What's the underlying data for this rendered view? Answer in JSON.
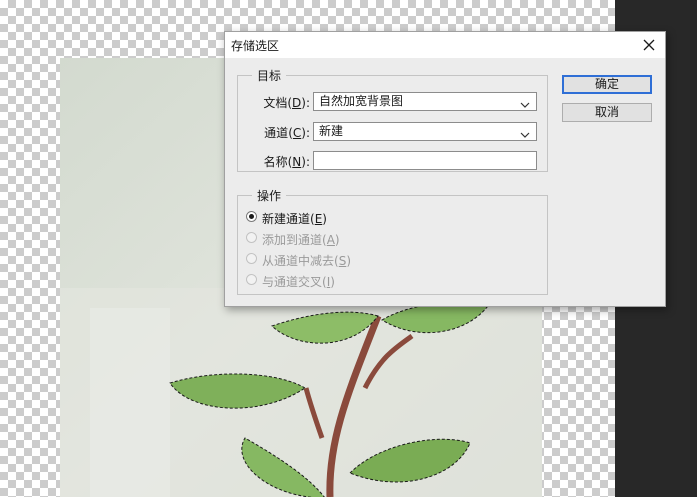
{
  "dialog": {
    "title": "存储选区",
    "target_group": {
      "label": "目标",
      "document": {
        "label": "文档",
        "accel": "D",
        "value": "自然加宽背景图"
      },
      "channel": {
        "label": "通道",
        "accel": "C",
        "value": "新建"
      },
      "name": {
        "label": "名称",
        "accel": "N",
        "value": ""
      }
    },
    "operation_group": {
      "label": "操作",
      "options": [
        {
          "label": "新建通道",
          "accel": "E",
          "checked": true,
          "enabled": true
        },
        {
          "label": "添加到通道",
          "accel": "A",
          "checked": false,
          "enabled": false
        },
        {
          "label": "从通道中减去",
          "accel": "S",
          "checked": false,
          "enabled": false
        },
        {
          "label": "与通道交叉",
          "accel": "I",
          "checked": false,
          "enabled": false
        }
      ]
    },
    "ok_label": "确定",
    "cancel_label": "取消"
  },
  "icons": {
    "close": "close-icon",
    "dropdown": "chevron-down-icon"
  },
  "colors": {
    "dark_panel": "#282828",
    "default_button_border": "#2f6fd6",
    "leaf": "#7fb05a",
    "stem": "#8a4a3c"
  }
}
